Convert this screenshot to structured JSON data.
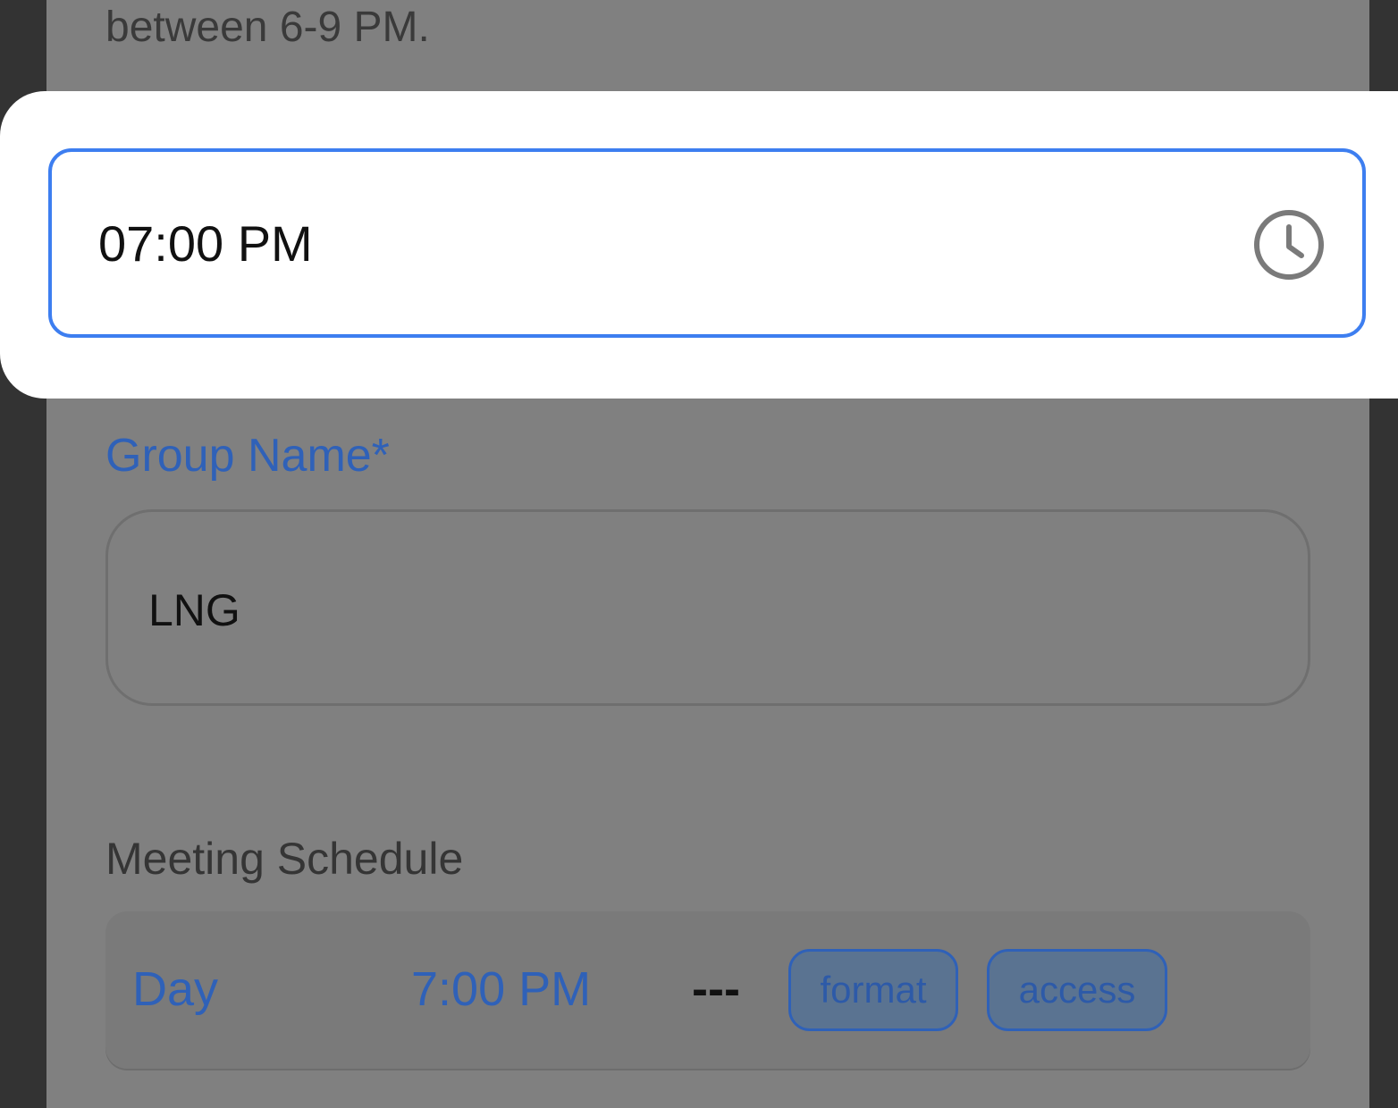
{
  "background_text": {
    "help_text": "between 6-9 PM."
  },
  "time_picker": {
    "value": "07:00 PM",
    "icon": "clock-icon"
  },
  "form": {
    "group_name_label": "Group Name*",
    "group_name_value": "LNG",
    "meeting_schedule_label": "Meeting Schedule"
  },
  "schedule": {
    "day": "Day",
    "time": "7:00 PM",
    "separator": "---",
    "tags": [
      "format",
      "access"
    ]
  },
  "colors": {
    "accent": "#3d7ef0",
    "link_blue": "#2f61b8",
    "overlay_gray": "#808080"
  }
}
